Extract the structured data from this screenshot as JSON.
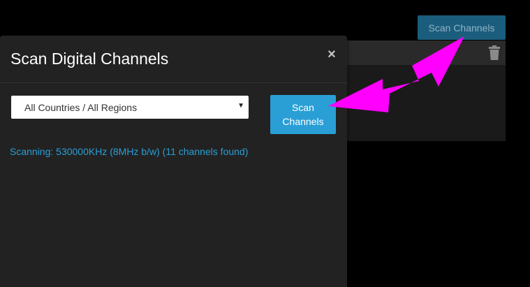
{
  "background": {
    "scan_button_label": "Scan Channels"
  },
  "modal": {
    "title": "Scan Digital Channels",
    "close_label": "×",
    "region_select": {
      "selected": "All Countries / All Regions"
    },
    "scan_button_label": "Scan Channels",
    "status": "Scanning: 530000KHz (8MHz b/w) (11 channels found)"
  },
  "colors": {
    "accent": "#2a9fd6",
    "annotation_arrow": "#ff00ff"
  },
  "icons": {
    "trash": "trash-icon",
    "close": "close-icon",
    "caret": "caret-down-icon"
  }
}
